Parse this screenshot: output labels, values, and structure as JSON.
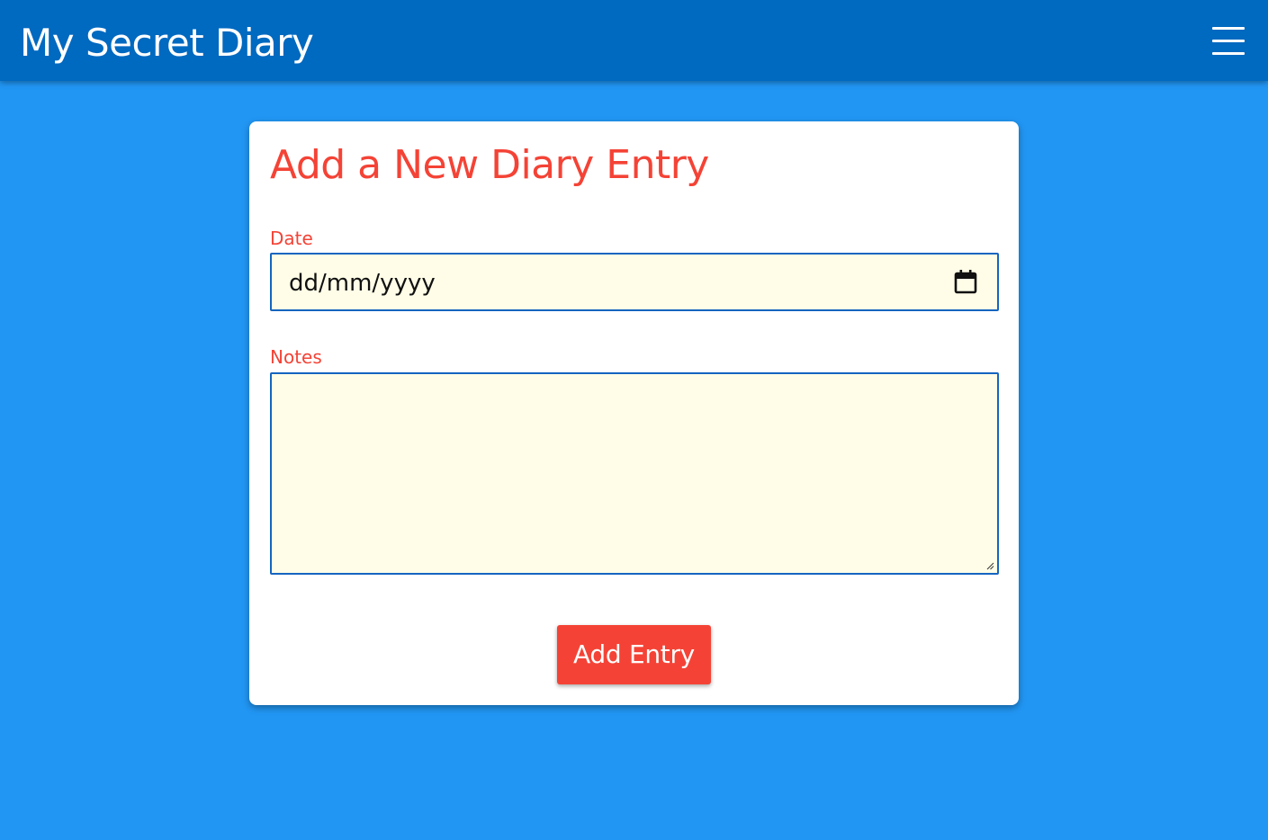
{
  "app_bar": {
    "title": "My Secret Diary",
    "menu_icon": "hamburger-menu-icon"
  },
  "form": {
    "title": "Add a New Diary Entry",
    "date": {
      "label": "Date",
      "placeholder": "dd/mm/yyyy",
      "value": "",
      "icon": "calendar-icon"
    },
    "notes": {
      "label": "Notes",
      "value": ""
    },
    "submit_label": "Add Entry"
  },
  "colors": {
    "page_background": "#2196f3",
    "app_bar_background": "#0069c0",
    "accent": "#f44336",
    "input_background": "#fffde7",
    "input_border": "#1565c0"
  }
}
